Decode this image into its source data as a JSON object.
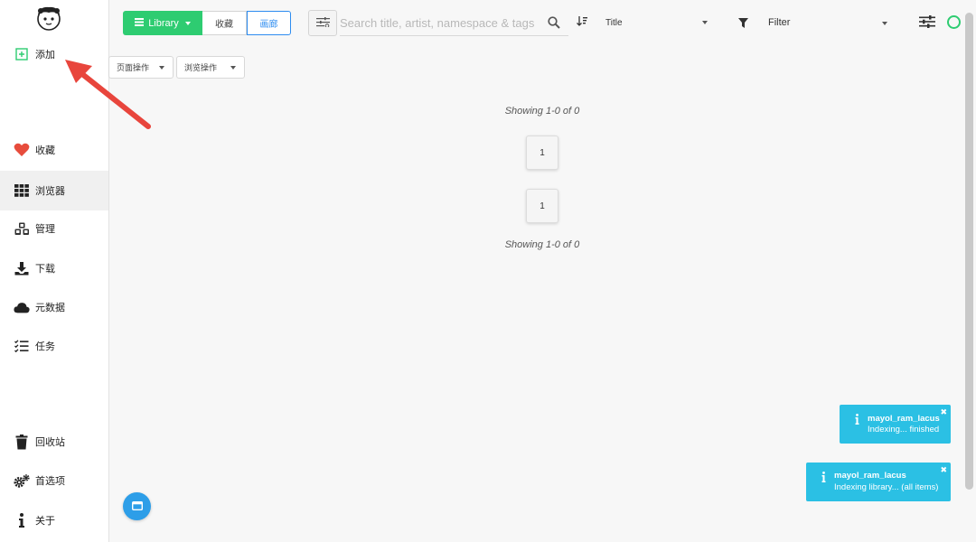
{
  "sidebar": {
    "items": [
      {
        "label": "添加",
        "icon": "plus-square-icon"
      },
      {
        "label": "收藏",
        "icon": "heart-icon"
      },
      {
        "label": "浏览器",
        "icon": "grid-icon"
      },
      {
        "label": "管理",
        "icon": "cubes-icon"
      },
      {
        "label": "下载",
        "icon": "download-icon"
      },
      {
        "label": "元数据",
        "icon": "cloud-icon"
      },
      {
        "label": "任务",
        "icon": "task-list-icon"
      },
      {
        "label": "回收站",
        "icon": "trash-icon"
      },
      {
        "label": "首选项",
        "icon": "cogs-icon"
      },
      {
        "label": "关于",
        "icon": "info-icon"
      }
    ],
    "active": "浏览器"
  },
  "toolbar": {
    "library_label": "Library",
    "favorites_label": "收藏",
    "gallery_label": "画廊",
    "search_placeholder": "Search title, artist, namespace & tags",
    "sort_label": "Title",
    "filter_label": "Filter"
  },
  "subbar": {
    "page_actions": "页面操作",
    "view_actions": "浏览操作"
  },
  "main": {
    "showing_top": "Showing 1-0 of 0",
    "showing_bottom": "Showing 1-0 of 0",
    "page_top": "1",
    "page_bottom": "1"
  },
  "toasts": [
    {
      "title": "mayol_ram_lacus",
      "message": "Indexing... finished"
    },
    {
      "title": "mayol_ram_lacus",
      "message": "Indexing library... (all items)"
    }
  ],
  "colors": {
    "accent_green": "#2ecc71",
    "accent_blue": "#2d8cf0",
    "toast_cyan": "#2bc0e4",
    "heart_red": "#e74c3c",
    "arrow_red": "#e8453c"
  }
}
